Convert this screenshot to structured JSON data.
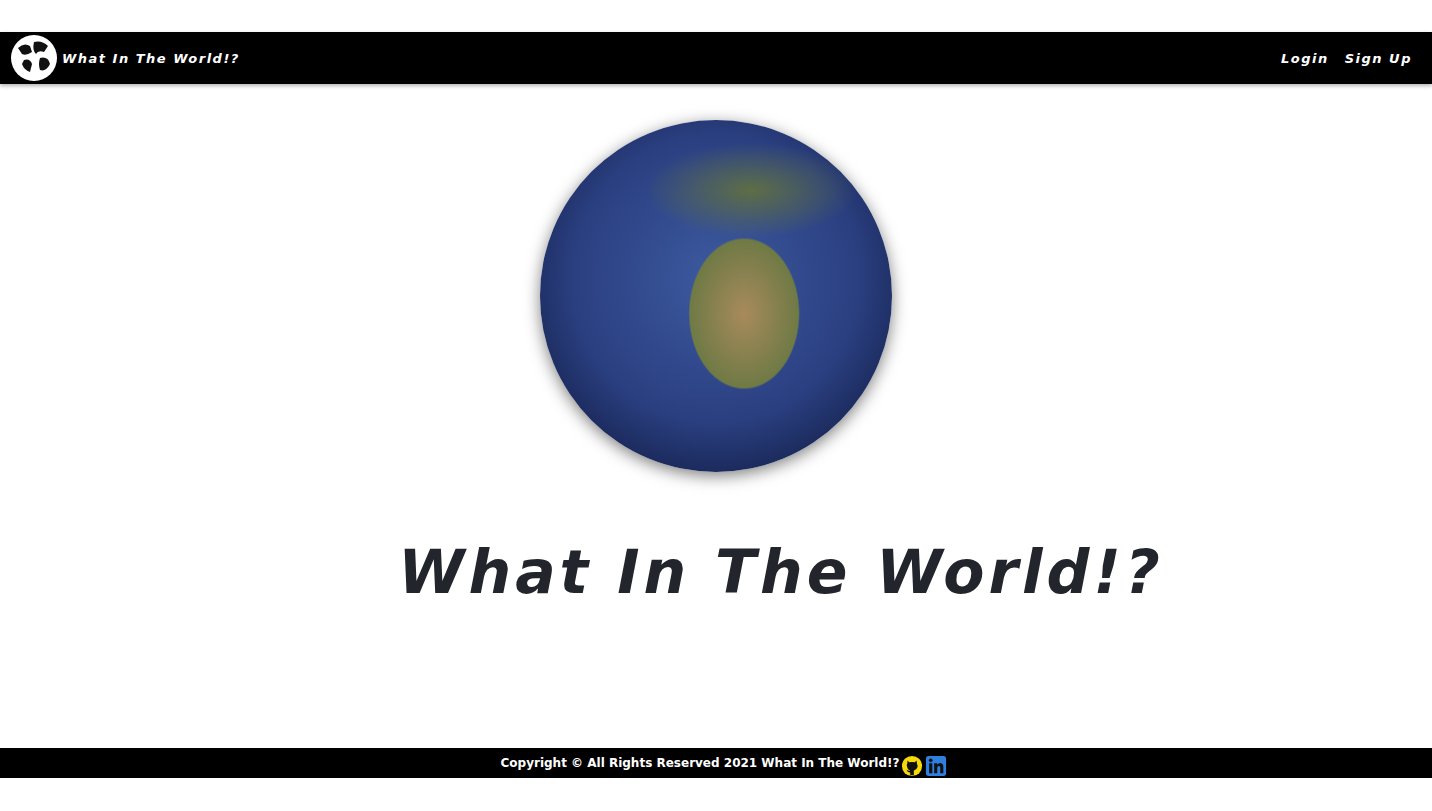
{
  "navbar": {
    "brand": "What In The World!?",
    "links": [
      {
        "label": "Login"
      },
      {
        "label": "Sign Up"
      }
    ]
  },
  "hero": {
    "title": "What In The World!?"
  },
  "footer": {
    "copyright": "Copyright © All Rights Reserved 2021 What In The World!?",
    "socials": [
      {
        "name": "github",
        "color": "#f5d90a"
      },
      {
        "name": "linkedin",
        "color": "#2f7fe0"
      }
    ]
  }
}
